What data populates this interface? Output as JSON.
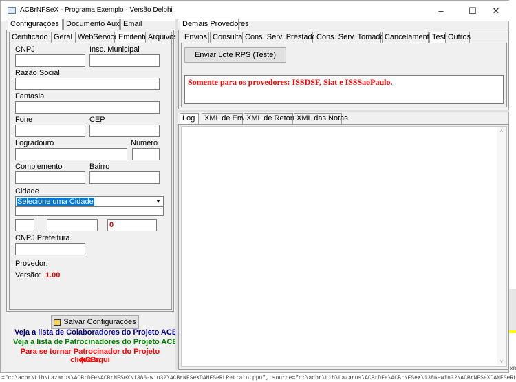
{
  "window": {
    "title": "ACBrNFSeX - Programa Exemplo - Versão Delphi",
    "min_label": "–",
    "max_label": "☐",
    "close_label": "✕"
  },
  "left_tabs": {
    "configuracoes": "Configurações",
    "documento_auxiliar": "Documento Auxiliar",
    "email": "Email"
  },
  "left_subtabs": {
    "certificado": "Certificado",
    "geral": "Geral",
    "webservice": "WebService",
    "emitente": "Emitente",
    "arquivos": "Arquivos"
  },
  "emitente": {
    "cnpj_label": "CNPJ",
    "insc_municipal_label": "Insc. Municipal",
    "razao_social_label": "Razão Social",
    "fantasia_label": "Fantasia",
    "fone_label": "Fone",
    "cep_label": "CEP",
    "logradouro_label": "Logradouro",
    "numero_label": "Número",
    "complemento_label": "Complemento",
    "bairro_label": "Bairro",
    "cidade_label": "Cidade",
    "cidade_value": "Selecione uma Cidade",
    "codigo_value": "0",
    "cnpj_prefeitura_label": "CNPJ Prefeitura",
    "provedor_label": "Provedor:",
    "versao_label": "Versão:",
    "versao_value": "1.00"
  },
  "bottom_left": {
    "salvar_label": "Salvar Configurações",
    "colaboradores_link": "Veja a lista de Colaboradores do Projeto ACBr",
    "patrocinadores_link": "Veja a lista de Patrocinadores do Projeto ACBr",
    "patrocinador_link_1": "Para se tornar Patrocinador do Projeto ACBr,",
    "patrocinador_link_2": "clique aqui"
  },
  "right_tabs": {
    "demais_provedores": "Demais Provedores"
  },
  "right_subtabs": {
    "envios": "Envios",
    "consultas": "Consultas",
    "cons_prestados": "Cons. Serv. Prestados",
    "cons_tomados": "Cons. Serv. Tomados",
    "cancelamento": "Cancelamento",
    "teste": "Teste",
    "outros": "Outros"
  },
  "teste_panel": {
    "enviar_button": "Enviar Lote RPS (Teste)",
    "notice": "Somente para os provedores: ISSDSF, Siat e ISSSaoPaulo."
  },
  "log_tabs": {
    "log": "Log",
    "xml_envio": "XML de Envio",
    "xml_retorno": "XML de Retorno",
    "xml_notas": "XML das Notas"
  },
  "background": {
    "status_line": "=\"c:\\acbr\\Lib\\Lazarus\\ACBrDFe\\ACBrNFSeX\\i386-win32\\ACBrNFSeXDANFSeRLRetrato.ppu\", source=\"c:\\acbr\\Lib\\Lazarus\\ACBrDFe\\ACBrNFSeX\\i386-win32\\ACBrNFSeXDANFSeRLRetrato.lfm\"",
    "right_edge_text": "XDA"
  }
}
